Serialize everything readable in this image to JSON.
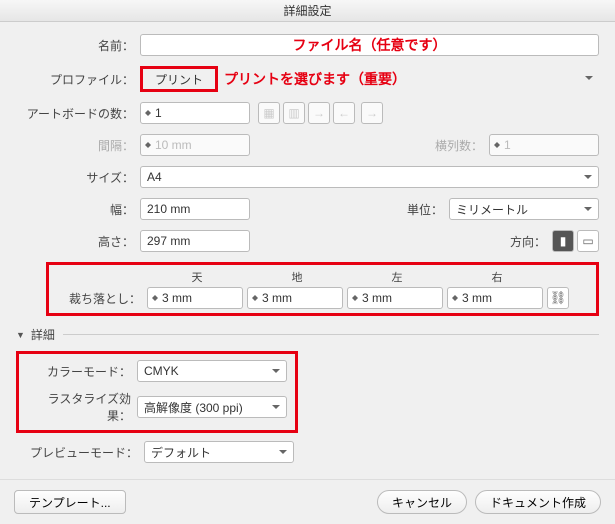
{
  "title": "詳細設定",
  "name": {
    "label": "名前：",
    "annotation": "ファイル名（任意です）"
  },
  "profile": {
    "label": "プロファイル：",
    "value": "プリント",
    "annotation": "プリントを選びます（重要）"
  },
  "artboards": {
    "label": "アートボードの数：",
    "value": "1"
  },
  "spacing": {
    "label": "間隔：",
    "value": "10 mm"
  },
  "columns": {
    "label": "横列数：",
    "value": "1"
  },
  "size": {
    "label": "サイズ：",
    "value": "A4"
  },
  "width": {
    "label": "幅：",
    "value": "210 mm"
  },
  "units": {
    "label": "単位：",
    "value": "ミリメートル"
  },
  "height": {
    "label": "高さ：",
    "value": "297 mm"
  },
  "orientation": {
    "label": "方向："
  },
  "bleed": {
    "label": "裁ち落とし：",
    "top": {
      "label": "天",
      "value": "3 mm"
    },
    "bottom": {
      "label": "地",
      "value": "3 mm"
    },
    "left": {
      "label": "左",
      "value": "3 mm"
    },
    "right": {
      "label": "右",
      "value": "3 mm"
    }
  },
  "advanced": {
    "label": "詳細"
  },
  "colormode": {
    "label": "カラーモード：",
    "value": "CMYK"
  },
  "raster": {
    "label": "ラスタライズ効果：",
    "value": "高解像度 (300 ppi)"
  },
  "preview": {
    "label": "プレビューモード：",
    "value": "デフォルト"
  },
  "footer": {
    "template": "テンプレート...",
    "cancel": "キャンセル",
    "create": "ドキュメント作成"
  }
}
